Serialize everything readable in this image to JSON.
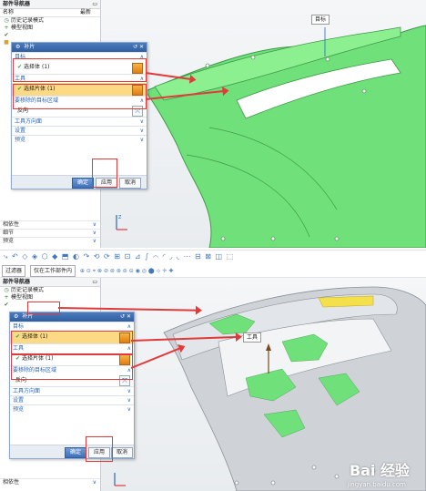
{
  "top": {
    "navigator": {
      "title": "部件导航器",
      "col_name": "名称",
      "col_recent": "最新",
      "history_mode": "历史记录模式",
      "model_view": "模型视图"
    },
    "dialog": {
      "title": "补片",
      "target_section": "目标",
      "target_value": "选择体 (1)",
      "tool_section": "工具",
      "tool_value": "选择片体 (1)",
      "region_section": "要移除的目标区域",
      "reverse_label": "反向",
      "tool_dir_section": "工具方向面",
      "settings_section": "设置",
      "preview_section": "预览",
      "ok": "确定",
      "apply": "应用",
      "cancel": "取消"
    },
    "side_list": [
      "相依性",
      "细节",
      "预览"
    ],
    "label_3d": "目标"
  },
  "toolbar": {
    "filter_combo": "过滤器",
    "scope_combo": "仅在工作部件内"
  },
  "bottom": {
    "navigator": {
      "title": "部件导航器",
      "history_mode": "历史记录模式",
      "model_view": "模型视图"
    },
    "dialog": {
      "title": "补片",
      "target_section": "目标",
      "target_value": "选择体 (1)",
      "tool_section": "工具",
      "tool_value": "选择片体 (1)",
      "region_section": "要移除的目标区域",
      "reverse_label": "反向",
      "tool_dir_section": "工具方向面",
      "settings_section": "设置",
      "preview_section": "预览",
      "ok": "确定",
      "apply": "应用",
      "cancel": "取消"
    },
    "side_list": [
      "相依性"
    ],
    "label_3d": "工具",
    "watermark": "Bai 经验",
    "watermark_url": "jingyan.baidu.com"
  },
  "colors": {
    "highlight": "#fbd985",
    "annotation": "#e23a3a",
    "model_green": "#6fe07a",
    "model_grey": "#cfd3d8"
  }
}
